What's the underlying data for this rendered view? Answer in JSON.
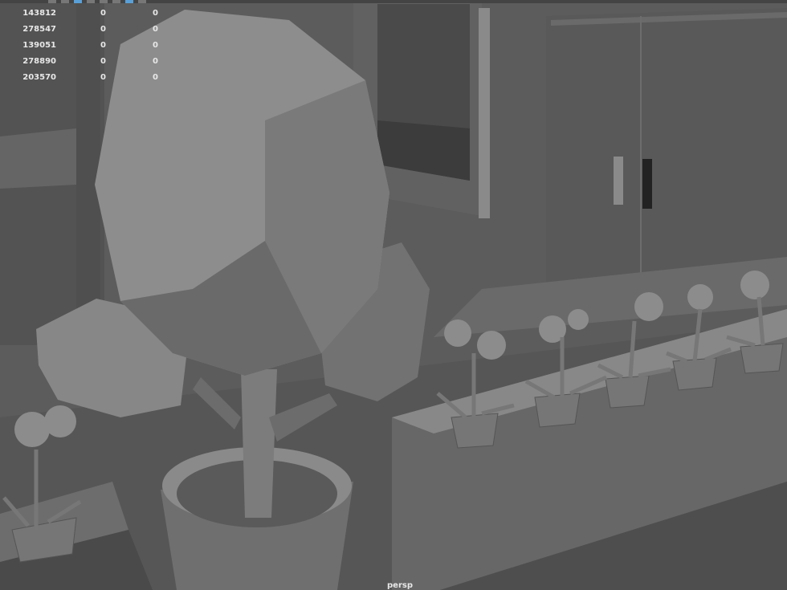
{
  "hud": {
    "rows": [
      [
        "143812",
        "0",
        "0"
      ],
      [
        "278547",
        "0",
        "0"
      ],
      [
        "139051",
        "0",
        "0"
      ],
      [
        "278890",
        "0",
        "0"
      ],
      [
        "203570",
        "0",
        "0"
      ]
    ]
  },
  "viewport": {
    "camera_label": "persp"
  },
  "colors": {
    "hud_text": "#e8e8e8",
    "background": "#5e5e5e",
    "toolbar_active": "#5aa0d8"
  }
}
